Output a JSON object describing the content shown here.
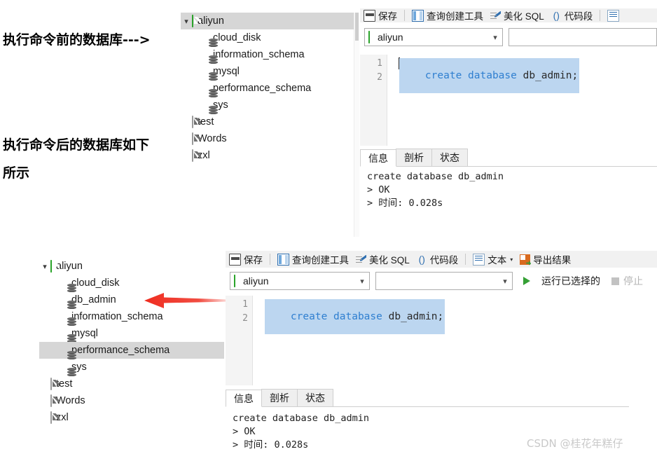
{
  "annotations": {
    "before_label": "执行命令前的数据库--->",
    "after_label_line1": "执行命令后的数据库如下",
    "after_label_line2": "所示",
    "arrow_name": "red-left-arrow"
  },
  "watermark": "CSDN @桂花年糕仔",
  "top_panel": {
    "tree": {
      "root": {
        "label": "aliyun",
        "icon": "connection-icon",
        "expanded": true,
        "selected": true
      },
      "children": [
        {
          "label": "cloud_disk",
          "icon": "database-icon"
        },
        {
          "label": "information_schema",
          "icon": "database-icon"
        },
        {
          "label": "mysql",
          "icon": "database-icon"
        },
        {
          "label": "performance_schema",
          "icon": "database-icon"
        },
        {
          "label": "sys",
          "icon": "database-icon"
        }
      ],
      "siblings": [
        {
          "label": "test",
          "icon": "connection-icon-grey"
        },
        {
          "label": "Words",
          "icon": "connection-icon-grey"
        },
        {
          "label": "zxl",
          "icon": "connection-icon-grey"
        }
      ]
    },
    "toolbar": [
      {
        "label": "保存",
        "icon": "save-icon"
      },
      {
        "label": "查询创建工具",
        "icon": "query-builder-icon"
      },
      {
        "label": "美化 SQL",
        "icon": "beautify-sql-icon"
      },
      {
        "label": "代码段",
        "icon": "snippet-icon"
      }
    ],
    "connection_combo": {
      "value": "aliyun",
      "icon": "connection-icon"
    },
    "database_combo": {
      "value": ""
    },
    "editor": {
      "lines": [
        "1",
        "2"
      ],
      "code_keyword": "create database",
      "code_identifier": " db_admin;"
    },
    "result_tabs": [
      {
        "label": "信息",
        "active": true
      },
      {
        "label": "剖析",
        "active": false
      },
      {
        "label": "状态",
        "active": false
      }
    ],
    "result_text": "create database db_admin\n> OK\n> 时间: 0.028s"
  },
  "bottom_panel": {
    "tree": {
      "root": {
        "label": "aliyun",
        "icon": "connection-icon",
        "expanded": true,
        "selected": false
      },
      "children": [
        {
          "label": "cloud_disk",
          "icon": "database-icon",
          "selected": false
        },
        {
          "label": "db_admin",
          "icon": "database-icon",
          "selected": false
        },
        {
          "label": "information_schema",
          "icon": "database-icon",
          "selected": false
        },
        {
          "label": "mysql",
          "icon": "database-icon",
          "selected": false
        },
        {
          "label": "performance_schema",
          "icon": "database-icon",
          "selected": true
        },
        {
          "label": "sys",
          "icon": "database-icon",
          "selected": false
        }
      ],
      "siblings": [
        {
          "label": "test",
          "icon": "connection-icon-grey"
        },
        {
          "label": "Words",
          "icon": "connection-icon-grey"
        },
        {
          "label": "zxl",
          "icon": "connection-icon-grey"
        }
      ]
    },
    "toolbar": [
      {
        "label": "保存",
        "icon": "save-icon"
      },
      {
        "label": "查询创建工具",
        "icon": "query-builder-icon"
      },
      {
        "label": "美化 SQL",
        "icon": "beautify-sql-icon"
      },
      {
        "label": "代码段",
        "icon": "snippet-icon"
      },
      {
        "label": "文本",
        "icon": "text-icon",
        "has_caret": true
      },
      {
        "label": "导出结果",
        "icon": "export-result-icon"
      }
    ],
    "connection_combo": {
      "value": "aliyun",
      "icon": "connection-icon"
    },
    "database_combo": {
      "value": ""
    },
    "run_button": {
      "label": "运行已选择的",
      "icon": "run-icon"
    },
    "stop_button": {
      "label": "停止",
      "icon": "stop-icon",
      "disabled": true
    },
    "editor": {
      "lines": [
        "1",
        "2"
      ],
      "code_keyword": "create database",
      "code_identifier": " db_admin;"
    },
    "result_tabs": [
      {
        "label": "信息",
        "active": true
      },
      {
        "label": "剖析",
        "active": false
      },
      {
        "label": "状态",
        "active": false
      }
    ],
    "result_text": "create database db_admin\n> OK\n> 时间: 0.028s"
  },
  "colors": {
    "accent_blue": "#2f7fd0",
    "selection_blue": "#bcd6f0",
    "tree_selection": "#d6d6d6",
    "green_connection": "#3dc13d",
    "arrow_red": "#ef2d20",
    "toolbar_bg": "#f1f1f1"
  }
}
